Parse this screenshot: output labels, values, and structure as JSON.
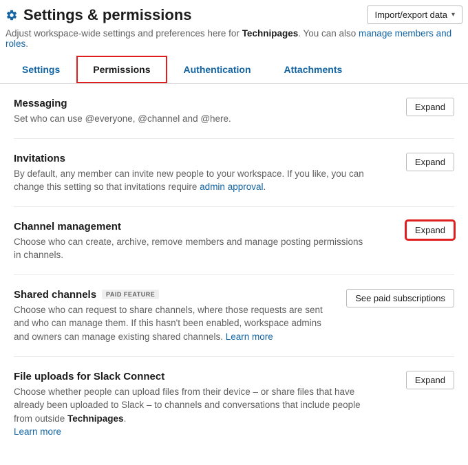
{
  "header": {
    "title": "Settings & permissions",
    "import_label": "Import/export data",
    "dropdown_glyph": "▾"
  },
  "subtitle": {
    "prefix": "Adjust workspace-wide settings and preferences here for ",
    "workspace": "Technipages",
    "middle": ". You can also ",
    "link": "manage members and roles",
    "suffix": "."
  },
  "tabs": {
    "settings": "Settings",
    "permissions": "Permissions",
    "authentication": "Authentication",
    "attachments": "Attachments"
  },
  "sections": {
    "messaging": {
      "title": "Messaging",
      "desc": "Set who can use @everyone, @channel and @here.",
      "action": "Expand"
    },
    "invitations": {
      "title": "Invitations",
      "desc_pre": "By default, any member can invite new people to your workspace. If you like, you can change this setting so that invitations require ",
      "link": "admin approval",
      "desc_post": ".",
      "action": "Expand"
    },
    "channel_management": {
      "title": "Channel management",
      "desc": "Choose who can create, archive, remove members and manage posting permissions in channels.",
      "action": "Expand"
    },
    "shared_channels": {
      "title": "Shared channels",
      "badge": "PAID FEATURE",
      "desc_pre": "Choose who can request to share channels, where those requests are sent and who can manage them. If this hasn't been enabled, workspace admins and owners can manage existing shared channels. ",
      "link": "Learn more",
      "action": "See paid subscriptions"
    },
    "file_uploads": {
      "title": "File uploads for Slack Connect",
      "desc_pre": "Choose whether people can upload files from their device – or share files that have already been uploaded to Slack – to channels and conversations that include people from outside ",
      "workspace": "Technipages",
      "desc_post": ". ",
      "link": "Learn more",
      "action": "Expand"
    }
  }
}
